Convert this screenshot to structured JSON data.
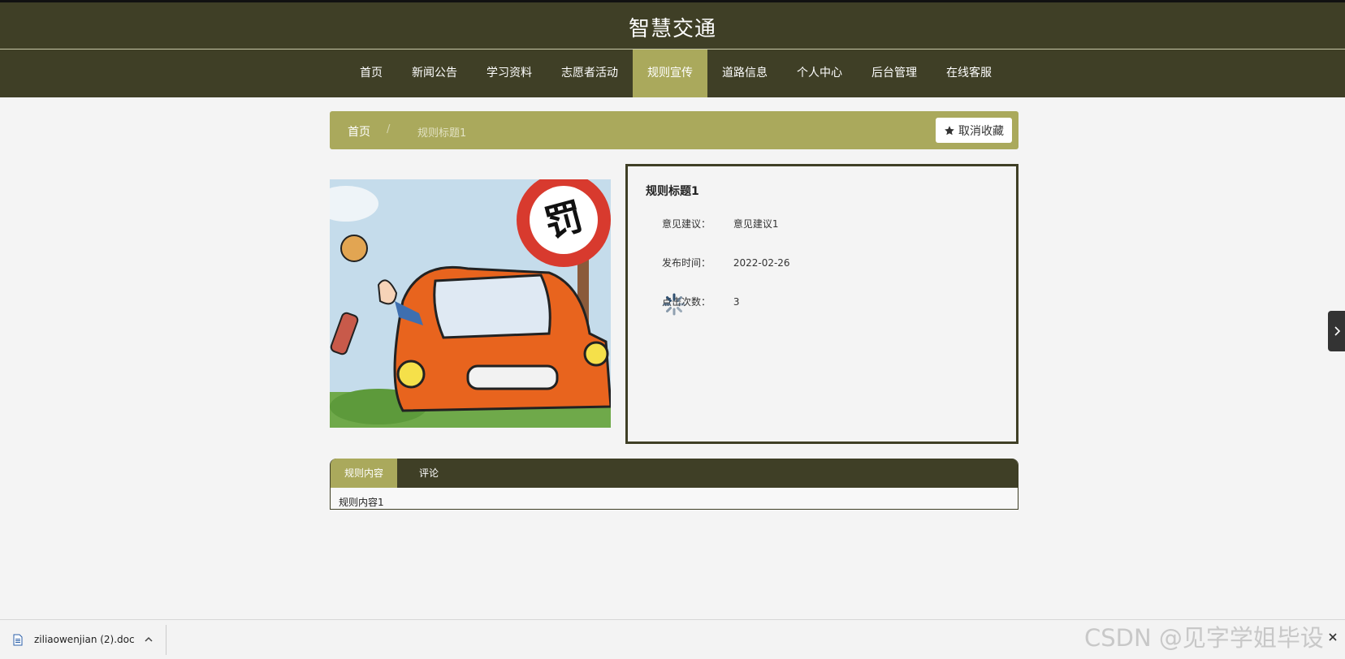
{
  "site": {
    "title": "智慧交通"
  },
  "nav": {
    "items": [
      {
        "label": "首页"
      },
      {
        "label": "新闻公告"
      },
      {
        "label": "学习资料"
      },
      {
        "label": "志愿者活动"
      },
      {
        "label": "规则宣传"
      },
      {
        "label": "道路信息"
      },
      {
        "label": "个人中心"
      },
      {
        "label": "后台管理"
      },
      {
        "label": "在线客服"
      }
    ],
    "active_index": 4
  },
  "breadcrumb": {
    "home": "首页",
    "separator": "/",
    "current": "规则标题1"
  },
  "favorite_button": {
    "label": "取消收藏",
    "icon": "star-icon"
  },
  "detail": {
    "title": "规则标题1",
    "fields": [
      {
        "label": "意见建议：",
        "value": "意见建议1"
      },
      {
        "label": "发布时间：",
        "value": "2022-02-26"
      },
      {
        "label": "点击次数：",
        "value": "3"
      }
    ]
  },
  "tabs": {
    "items": [
      {
        "label": "规则内容"
      },
      {
        "label": "评论"
      }
    ],
    "active_index": 0,
    "content": "规则内容1"
  },
  "illustration": {
    "sign_text": "罚"
  },
  "download_bar": {
    "file_name": "ziliaowenjian (2).doc"
  },
  "watermark": "CSDN @见字学姐毕设",
  "colors": {
    "nav_bg": "#3f3f26",
    "accent": "#aaa95c",
    "page_bg": "#f4f4f4"
  }
}
